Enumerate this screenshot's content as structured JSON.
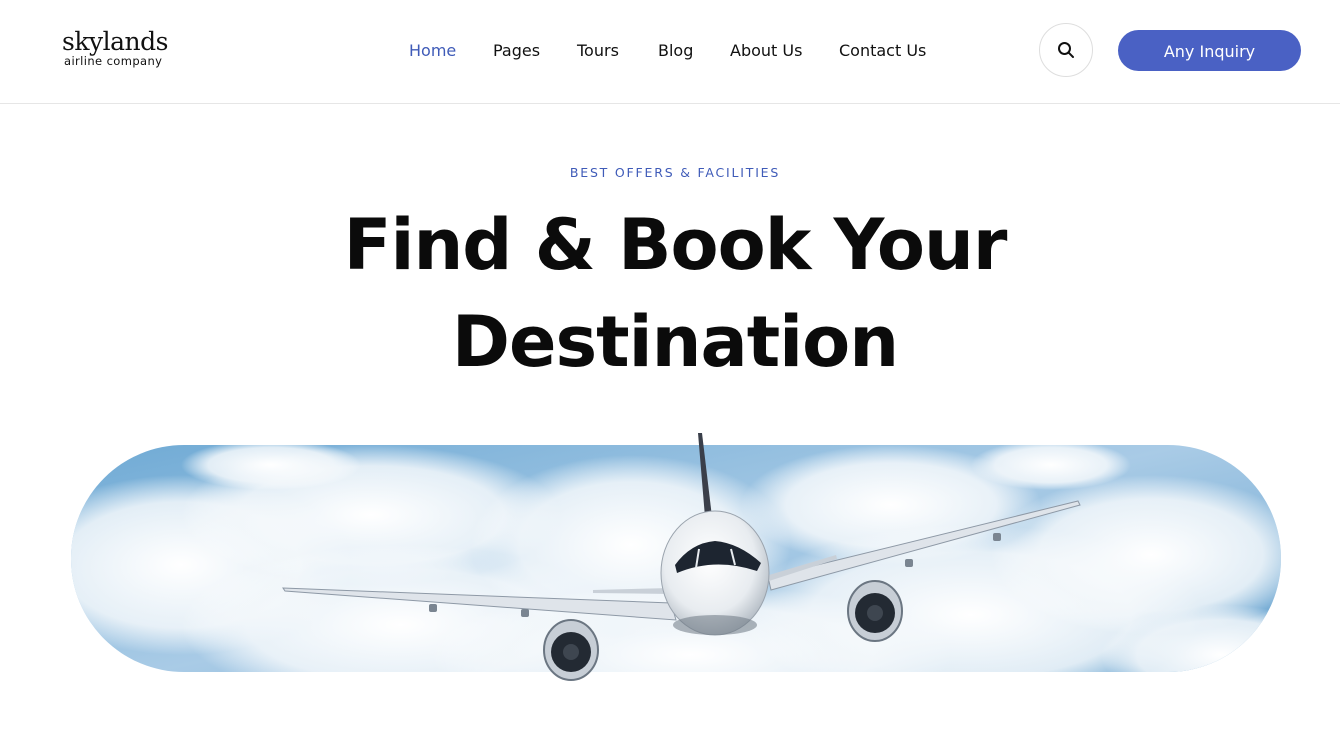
{
  "logo": {
    "name": "skylands",
    "tagline": "airline company"
  },
  "nav": {
    "items": [
      {
        "label": "Home",
        "active": true
      },
      {
        "label": "Pages",
        "active": false
      },
      {
        "label": "Tours",
        "active": false
      },
      {
        "label": "Blog",
        "active": false
      },
      {
        "label": "About Us",
        "active": false
      },
      {
        "label": "Contact Us",
        "active": false
      }
    ]
  },
  "header": {
    "search_icon": "search-icon",
    "cta_label": "Any Inquiry"
  },
  "hero": {
    "eyebrow": "BEST OFFERS & FACILITIES",
    "title_line1": "Find & Book Your",
    "title_line2": "Destination",
    "image": "airplane-in-clouds"
  },
  "colors": {
    "accent": "#4a61c4",
    "active_link": "#3f5bb8",
    "text": "#111111"
  }
}
